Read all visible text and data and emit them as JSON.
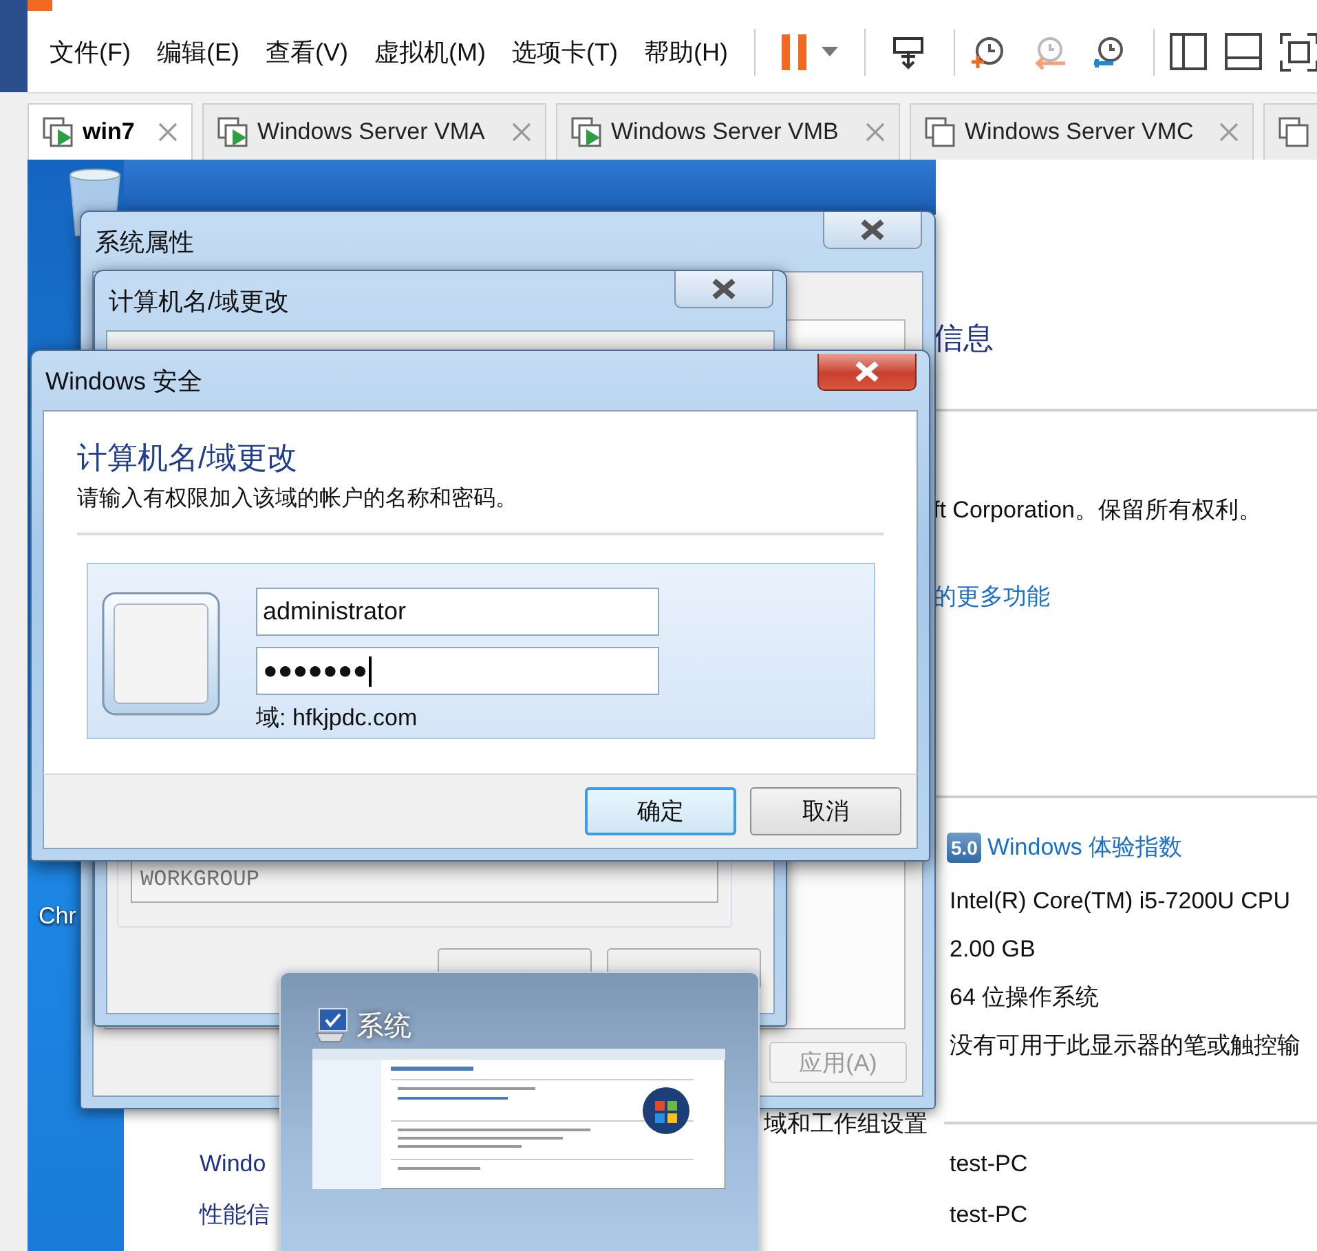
{
  "menu": [
    {
      "label": "文件(F)"
    },
    {
      "label": "编辑(E)"
    },
    {
      "label": "查看(V)"
    },
    {
      "label": "虚拟机(M)"
    },
    {
      "label": "选项卡(T)"
    },
    {
      "label": "帮助(H)"
    }
  ],
  "tabs": [
    {
      "label": "win7",
      "selected": true,
      "running": true
    },
    {
      "label": "Windows Server VMA",
      "selected": false,
      "running": true
    },
    {
      "label": "Windows Server VMB",
      "selected": false,
      "running": true
    },
    {
      "label": "Windows Server VMC",
      "selected": false,
      "running": false
    },
    {
      "selected": false,
      "running": false
    }
  ],
  "desktop_icons": [
    {
      "label": "Chr"
    }
  ],
  "control_panel": {
    "heading": "信息",
    "copyright": "ft Corporation。保留所有权利。",
    "more_link": "的更多功能",
    "rating_badge": "5.0",
    "rating_link": "Windows 体验指数",
    "specs": [
      "Intel(R) Core(TM) i5-7200U CPU",
      "2.00 GB",
      "64 位操作系统",
      "没有可用于此显示器的笔或触控输"
    ],
    "section_heading": "域和工作组设置",
    "see_also_links": [
      "Windo",
      "性能信"
    ],
    "values": [
      "test-PC",
      "test-PC"
    ]
  },
  "system_properties": {
    "title": "系统属性",
    "apply_button": {
      "label": "应用(A)",
      "disabled": true
    }
  },
  "computer_name_dialog": {
    "title": "计算机名/域更改",
    "workgroup": "WORKGROUP"
  },
  "security_dialog": {
    "title": "Windows 安全",
    "heading": "计算机名/域更改",
    "instruction": "请输入有权限加入该域的帐户的名称和密码。",
    "username": "administrator",
    "password": "●●●●●●●",
    "domain": "域: hfkjpdc.com",
    "buttons": [
      {
        "label": "确定",
        "default": true
      },
      {
        "label": "取消",
        "default": false
      }
    ]
  },
  "thumbnail": {
    "title": "系统"
  }
}
